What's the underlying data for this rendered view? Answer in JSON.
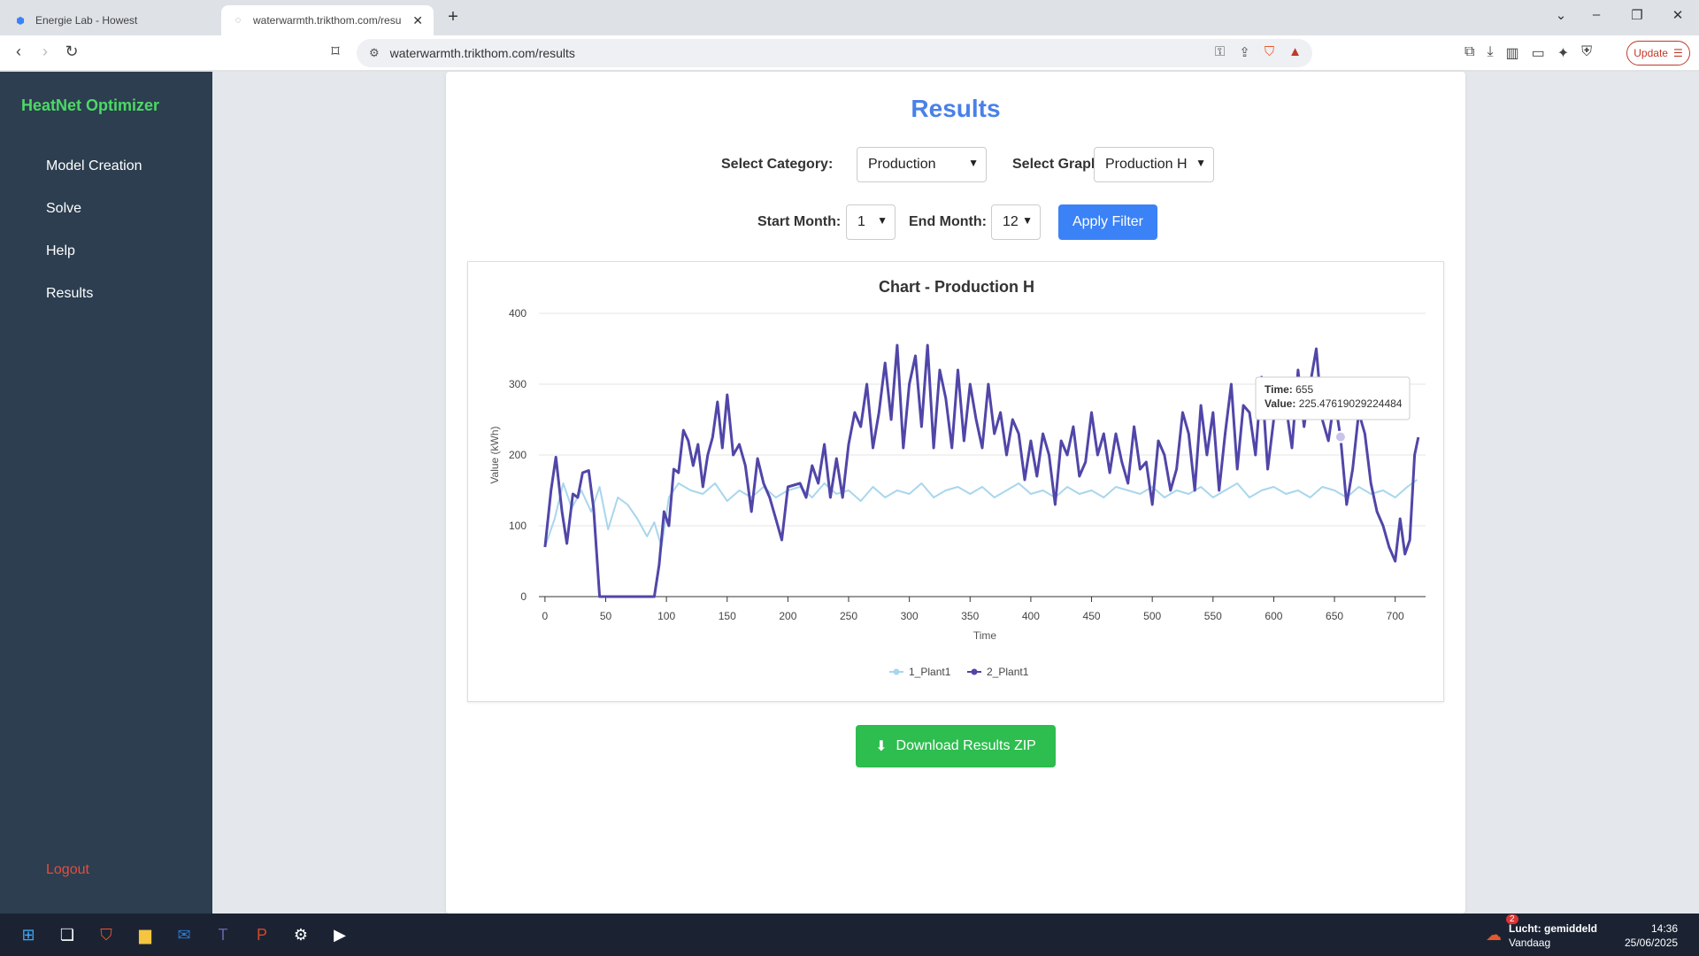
{
  "browser": {
    "tabs": [
      {
        "title": "Energie Lab - Howest",
        "active": false
      },
      {
        "title": "waterwarmth.trikthom.com/resu",
        "active": true
      }
    ],
    "url": "waterwarmth.trikthom.com/results",
    "update_label": "Update"
  },
  "sidebar": {
    "brand": "HeatNet Optimizer",
    "items": [
      {
        "label": "Model Creation"
      },
      {
        "label": "Solve"
      },
      {
        "label": "Help"
      },
      {
        "label": "Results"
      }
    ],
    "logout": "Logout"
  },
  "main": {
    "title": "Results",
    "category_label": "Select Category:",
    "category_value": "Production",
    "graph_label": "Select Graph:",
    "graph_value": "Production H",
    "start_label": "Start Month:",
    "start_value": "1",
    "end_label": "End Month:",
    "end_value": "12",
    "apply_label": "Apply Filter",
    "download_label": "Download Results ZIP"
  },
  "chart_data": {
    "type": "line",
    "title": "Chart - Production H",
    "xlabel": "Time",
    "ylabel": "Value (kWh)",
    "xlim": [
      -5,
      725
    ],
    "ylim": [
      0,
      400
    ],
    "x_ticks": [
      0,
      50,
      100,
      150,
      200,
      250,
      300,
      350,
      400,
      450,
      500,
      550,
      600,
      650,
      700
    ],
    "y_ticks": [
      0,
      100,
      200,
      300,
      400
    ],
    "grid": true,
    "legend_position": "bottom",
    "tooltip": {
      "time_label": "Time:",
      "time_value": "655",
      "value_label": "Value:",
      "value_value": "225.47619029224484"
    },
    "series": [
      {
        "name": "1_Plant1",
        "color": "#a9d6ec",
        "points": [
          [
            0,
            70
          ],
          [
            8,
            110
          ],
          [
            15,
            160
          ],
          [
            22,
            125
          ],
          [
            30,
            150
          ],
          [
            38,
            120
          ],
          [
            45,
            155
          ],
          [
            52,
            95
          ],
          [
            60,
            140
          ],
          [
            68,
            130
          ],
          [
            76,
            110
          ],
          [
            84,
            85
          ],
          [
            90,
            105
          ],
          [
            96,
            70
          ],
          [
            102,
            140
          ],
          [
            110,
            160
          ],
          [
            120,
            150
          ],
          [
            130,
            145
          ],
          [
            140,
            160
          ],
          [
            150,
            135
          ],
          [
            160,
            150
          ],
          [
            170,
            140
          ],
          [
            180,
            155
          ],
          [
            190,
            140
          ],
          [
            200,
            150
          ],
          [
            210,
            155
          ],
          [
            220,
            140
          ],
          [
            230,
            160
          ],
          [
            240,
            145
          ],
          [
            250,
            150
          ],
          [
            260,
            135
          ],
          [
            270,
            155
          ],
          [
            280,
            140
          ],
          [
            290,
            150
          ],
          [
            300,
            145
          ],
          [
            310,
            160
          ],
          [
            320,
            140
          ],
          [
            330,
            150
          ],
          [
            340,
            155
          ],
          [
            350,
            145
          ],
          [
            360,
            155
          ],
          [
            370,
            140
          ],
          [
            380,
            150
          ],
          [
            390,
            160
          ],
          [
            400,
            145
          ],
          [
            410,
            150
          ],
          [
            420,
            140
          ],
          [
            430,
            155
          ],
          [
            440,
            145
          ],
          [
            450,
            150
          ],
          [
            460,
            140
          ],
          [
            470,
            155
          ],
          [
            480,
            150
          ],
          [
            490,
            145
          ],
          [
            500,
            155
          ],
          [
            510,
            140
          ],
          [
            520,
            150
          ],
          [
            530,
            145
          ],
          [
            540,
            155
          ],
          [
            550,
            140
          ],
          [
            560,
            150
          ],
          [
            570,
            160
          ],
          [
            580,
            140
          ],
          [
            590,
            150
          ],
          [
            600,
            155
          ],
          [
            610,
            145
          ],
          [
            620,
            150
          ],
          [
            630,
            140
          ],
          [
            640,
            155
          ],
          [
            650,
            150
          ],
          [
            660,
            140
          ],
          [
            670,
            155
          ],
          [
            680,
            145
          ],
          [
            690,
            150
          ],
          [
            700,
            140
          ],
          [
            710,
            155
          ],
          [
            718,
            165
          ]
        ]
      },
      {
        "name": "2_Plant1",
        "color": "#5046a8",
        "points": [
          [
            0,
            70
          ],
          [
            5,
            150
          ],
          [
            9,
            197
          ],
          [
            14,
            120
          ],
          [
            18,
            75
          ],
          [
            23,
            145
          ],
          [
            27,
            140
          ],
          [
            31,
            175
          ],
          [
            36,
            178
          ],
          [
            40,
            125
          ],
          [
            45,
            0
          ],
          [
            60,
            0
          ],
          [
            75,
            0
          ],
          [
            90,
            0
          ],
          [
            94,
            45
          ],
          [
            98,
            120
          ],
          [
            102,
            100
          ],
          [
            106,
            180
          ],
          [
            110,
            175
          ],
          [
            114,
            235
          ],
          [
            118,
            220
          ],
          [
            122,
            185
          ],
          [
            126,
            215
          ],
          [
            130,
            155
          ],
          [
            134,
            200
          ],
          [
            138,
            225
          ],
          [
            142,
            275
          ],
          [
            146,
            210
          ],
          [
            150,
            285
          ],
          [
            155,
            200
          ],
          [
            160,
            215
          ],
          [
            165,
            185
          ],
          [
            170,
            120
          ],
          [
            175,
            195
          ],
          [
            180,
            160
          ],
          [
            185,
            140
          ],
          [
            190,
            110
          ],
          [
            195,
            80
          ],
          [
            200,
            155
          ],
          [
            210,
            160
          ],
          [
            215,
            140
          ],
          [
            220,
            185
          ],
          [
            225,
            160
          ],
          [
            230,
            215
          ],
          [
            235,
            140
          ],
          [
            240,
            195
          ],
          [
            245,
            140
          ],
          [
            250,
            215
          ],
          [
            255,
            260
          ],
          [
            260,
            240
          ],
          [
            265,
            300
          ],
          [
            270,
            210
          ],
          [
            275,
            260
          ],
          [
            280,
            330
          ],
          [
            285,
            250
          ],
          [
            290,
            355
          ],
          [
            295,
            210
          ],
          [
            300,
            300
          ],
          [
            305,
            340
          ],
          [
            310,
            240
          ],
          [
            315,
            355
          ],
          [
            320,
            210
          ],
          [
            325,
            320
          ],
          [
            330,
            280
          ],
          [
            335,
            210
          ],
          [
            340,
            320
          ],
          [
            345,
            220
          ],
          [
            350,
            300
          ],
          [
            355,
            250
          ],
          [
            360,
            210
          ],
          [
            365,
            300
          ],
          [
            370,
            230
          ],
          [
            375,
            260
          ],
          [
            380,
            200
          ],
          [
            385,
            250
          ],
          [
            390,
            230
          ],
          [
            395,
            165
          ],
          [
            400,
            220
          ],
          [
            405,
            170
          ],
          [
            410,
            230
          ],
          [
            415,
            200
          ],
          [
            420,
            130
          ],
          [
            425,
            220
          ],
          [
            430,
            200
          ],
          [
            435,
            240
          ],
          [
            440,
            170
          ],
          [
            445,
            190
          ],
          [
            450,
            260
          ],
          [
            455,
            200
          ],
          [
            460,
            230
          ],
          [
            465,
            175
          ],
          [
            470,
            230
          ],
          [
            475,
            190
          ],
          [
            480,
            160
          ],
          [
            485,
            240
          ],
          [
            490,
            180
          ],
          [
            495,
            190
          ],
          [
            500,
            130
          ],
          [
            505,
            220
          ],
          [
            510,
            200
          ],
          [
            515,
            150
          ],
          [
            520,
            180
          ],
          [
            525,
            260
          ],
          [
            530,
            230
          ],
          [
            535,
            150
          ],
          [
            540,
            270
          ],
          [
            545,
            200
          ],
          [
            550,
            260
          ],
          [
            555,
            150
          ],
          [
            560,
            230
          ],
          [
            565,
            300
          ],
          [
            570,
            180
          ],
          [
            575,
            270
          ],
          [
            580,
            260
          ],
          [
            585,
            200
          ],
          [
            590,
            310
          ],
          [
            595,
            180
          ],
          [
            600,
            250
          ],
          [
            605,
            300
          ],
          [
            610,
            270
          ],
          [
            615,
            210
          ],
          [
            620,
            320
          ],
          [
            625,
            240
          ],
          [
            630,
            300
          ],
          [
            635,
            350
          ],
          [
            640,
            250
          ],
          [
            645,
            220
          ],
          [
            650,
            280
          ],
          [
            655,
            225
          ],
          [
            660,
            130
          ],
          [
            665,
            180
          ],
          [
            670,
            260
          ],
          [
            675,
            230
          ],
          [
            680,
            160
          ],
          [
            685,
            120
          ],
          [
            690,
            100
          ],
          [
            695,
            70
          ],
          [
            700,
            50
          ],
          [
            704,
            110
          ],
          [
            708,
            60
          ],
          [
            712,
            80
          ],
          [
            716,
            200
          ],
          [
            719,
            225
          ]
        ]
      }
    ]
  },
  "taskbar": {
    "weather_title": "Lucht: gemiddeld",
    "weather_sub": "Vandaag",
    "time": "14:36",
    "date": "25/06/2025",
    "badge_count": "2"
  },
  "colors": {
    "sidebar_bg": "#2c3e50",
    "brand_green": "#4cd964",
    "title_blue": "#4a80e8",
    "apply_blue": "#3b82f6",
    "download_green": "#2ebd4f",
    "logout_red": "#e74c3c"
  }
}
